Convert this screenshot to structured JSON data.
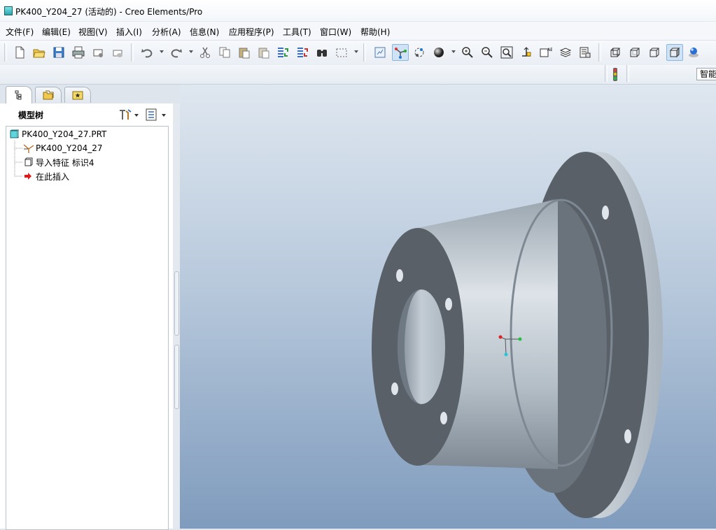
{
  "window": {
    "title": "PK400_Y204_27 (活动的) - Creo Elements/Pro",
    "icon": "model-part-icon"
  },
  "menu": [
    "文件(F)",
    "编辑(E)",
    "视图(V)",
    "插入(I)",
    "分析(A)",
    "信息(N)",
    "应用程序(P)",
    "工具(T)",
    "窗口(W)",
    "帮助(H)"
  ],
  "toolbar": {
    "icons": [
      "new-icon",
      "open-icon",
      "save-icon",
      "print-icon",
      "send-email-icon",
      "email-attachment-icon",
      "undo-icon",
      "redo-icon",
      "cut-icon",
      "copy-icon",
      "paste-icon",
      "paste-special-icon",
      "regenerate-icon",
      "regen-manager-icon",
      "find-icon",
      "selection-box-icon",
      "repaint-icon",
      "spin-center-icon",
      "orient-mode-icon",
      "display-style-icon",
      "zoom-in-icon",
      "zoom-out-icon",
      "refit-icon",
      "reorient-icon",
      "saved-views-icon",
      "layers-icon",
      "view-manager-icon",
      "wireframe-icon",
      "hidden-line-icon",
      "no-hidden-icon",
      "shading-icon",
      "enhanced-realism-icon"
    ],
    "smart_filter": "智能"
  },
  "navigator": {
    "tabs": [
      "model-tree-tab-icon",
      "folder-browser-tab-icon",
      "favorites-tab-icon"
    ],
    "panel_title": "模型树",
    "settings_icon": "tree-settings-icon",
    "show_icon": "tree-show-icon"
  },
  "model_tree": [
    {
      "label": "PK400_Y204_27.PRT",
      "icon": "part-icon"
    },
    {
      "label": "PK400_Y204_27",
      "icon": "coordinate-system-icon"
    },
    {
      "label": "导入特征 标识4",
      "icon": "import-feature-icon"
    },
    {
      "label": "在此插入",
      "icon": "insert-here-arrow-icon"
    }
  ],
  "colors": {
    "viewport_top": "#dfe7f0",
    "viewport_bottom": "#7f9bbd",
    "model_face": "#5a6068",
    "model_body": "#b7c0c9"
  }
}
